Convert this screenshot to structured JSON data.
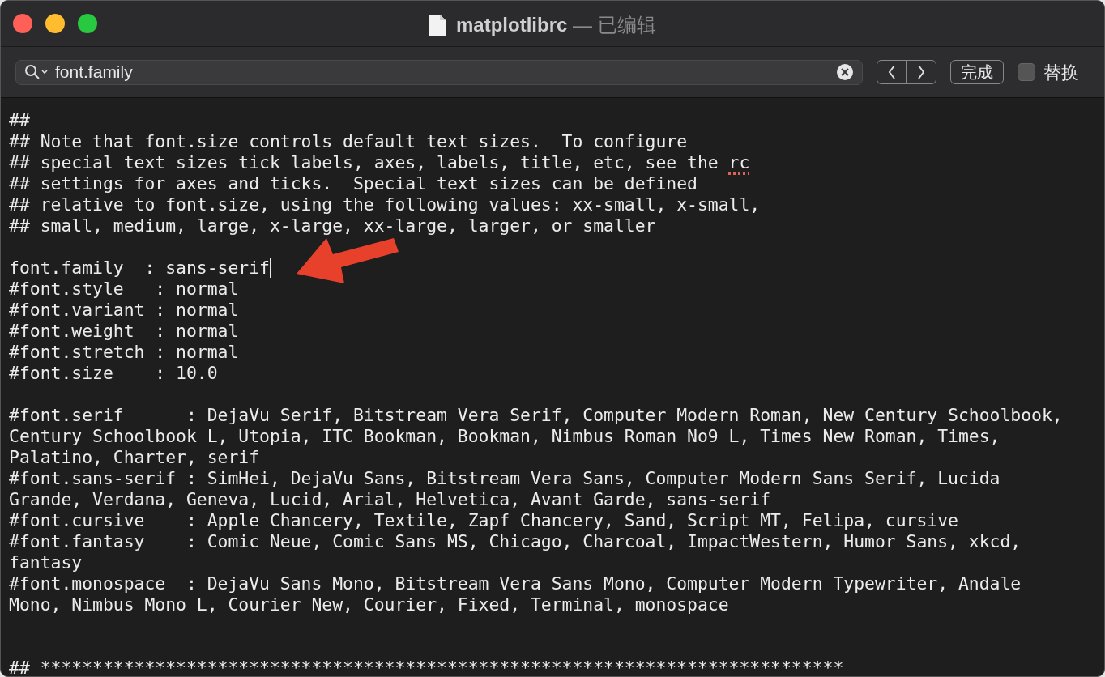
{
  "window": {
    "title": "matplotlibrc",
    "status": "— 已编辑"
  },
  "find_bar": {
    "query": "font.family",
    "done_button": "完成",
    "replace": {
      "label": "替换",
      "checked": false
    }
  },
  "editor": {
    "blocks": [
      [
        {
          "text": "##"
        },
        {
          "text": "## Note that font.size controls default text sizes.  To configure"
        },
        {
          "text": "## special text sizes tick labels, axes, labels, title, etc, see the ",
          "flagged_word": "rc"
        },
        {
          "text": "## settings for axes and ticks.  Special text sizes can be defined"
        },
        {
          "text": "## relative to font.size, using the following values: xx-small, x-small,"
        },
        {
          "text": "## small, medium, large, x-large, xx-large, larger, or smaller"
        }
      ],
      [
        {
          "text": "font.family  : sans-serif",
          "cursor": true
        },
        {
          "text": "#font.style   : normal"
        },
        {
          "text": "#font.variant : normal"
        },
        {
          "text": "#font.weight  : normal"
        },
        {
          "text": "#font.stretch : normal"
        },
        {
          "text": "#font.size    : 10.0"
        }
      ],
      [
        {
          "text": "#font.serif      : DejaVu Serif, Bitstream Vera Serif, Computer Modern Roman, New Century Schoolbook,"
        },
        {
          "text": "Century Schoolbook L, Utopia, ITC Bookman, Bookman, Nimbus Roman No9 L, Times New Roman, Times,"
        },
        {
          "text": "Palatino, Charter, serif"
        },
        {
          "text": "#font.sans-serif : SimHei, DejaVu Sans, Bitstream Vera Sans, Computer Modern Sans Serif, Lucida"
        },
        {
          "text": "Grande, Verdana, Geneva, Lucid, Arial, Helvetica, Avant Garde, sans-serif"
        },
        {
          "text": "#font.cursive    : Apple Chancery, Textile, Zapf Chancery, Sand, Script MT, Felipa, cursive"
        },
        {
          "text": "#font.fantasy    : Comic Neue, Comic Sans MS, Chicago, Charcoal, ImpactWestern, Humor Sans, xkcd,"
        },
        {
          "text": "fantasy"
        },
        {
          "text": "#font.monospace  : DejaVu Sans Mono, Bitstream Vera Sans Mono, Computer Modern Typewriter, Andale"
        },
        {
          "text": "Mono, Nimbus Mono L, Courier New, Courier, Fixed, Terminal, monospace"
        }
      ],
      [
        {
          "text": "## *****************************************************************************"
        }
      ]
    ]
  }
}
